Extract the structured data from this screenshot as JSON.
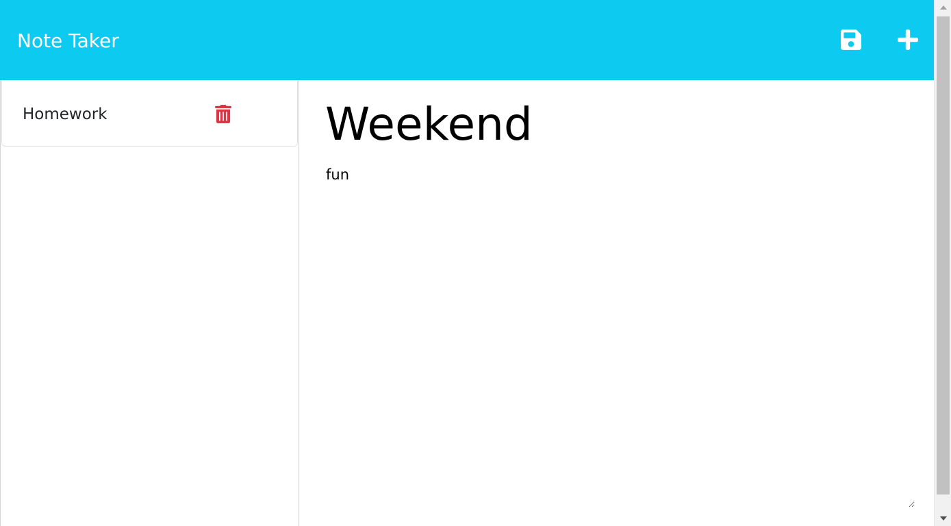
{
  "colors": {
    "accent": "#0dcaf0",
    "delete": "#dc3545",
    "icon_on_navbar": "#ffffff"
  },
  "navbar": {
    "brand": "Note Taker",
    "save_icon": "save-icon",
    "new_icon": "plus-icon"
  },
  "sidebar": {
    "notes": [
      {
        "title": "Homework",
        "delete_icon": "trash-icon"
      }
    ]
  },
  "editor": {
    "title": "Weekend",
    "text": "fun"
  },
  "scrollbar": {
    "up_icon": "arrow-up-icon",
    "down_icon": "arrow-down-icon"
  }
}
